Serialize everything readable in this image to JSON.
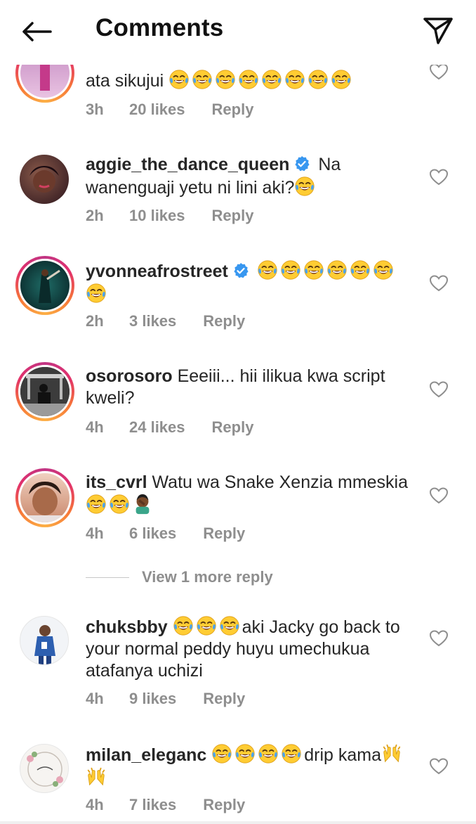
{
  "header": {
    "title": "Comments"
  },
  "comments": [
    {
      "username": "",
      "verified": false,
      "ring": true,
      "text_a": "ata sikujui ",
      "text_b": "",
      "time": "3h",
      "likes": "20 likes",
      "reply": "Reply",
      "avatar_color": "#d9a9d3"
    },
    {
      "username": "aggie_the_dance_queen",
      "verified": true,
      "ring": false,
      "text_a": "Na wanenguaji yetu ni lini aki?",
      "text_b": "",
      "time": "2h",
      "likes": "10 likes",
      "reply": "Reply",
      "avatar_color": "#3a1f2a"
    },
    {
      "username": "yvonneafrostreet",
      "verified": true,
      "ring": true,
      "text_a": "",
      "text_b": "",
      "time": "2h",
      "likes": "3 likes",
      "reply": "Reply",
      "avatar_color": "#0f3f3f"
    },
    {
      "username": "osorosoro",
      "verified": false,
      "ring": true,
      "text_a": "Eeeiii... hii ilikua kwa script kweli?",
      "text_b": "",
      "time": "4h",
      "likes": "24 likes",
      "reply": "Reply",
      "avatar_color": "#2a2a2a"
    },
    {
      "username": "its_cvrl",
      "verified": false,
      "ring": true,
      "text_a": "Watu wa Snake Xenzia mmeskia",
      "text_b": "",
      "time": "4h",
      "likes": "6 likes",
      "reply": "Reply",
      "avatar_color": "#d8a27a"
    },
    {
      "username": "chuksbby",
      "verified": false,
      "ring": false,
      "text_a": "aki Jacky go back to your normal peddy huyu umechukua atafanya uchizi",
      "text_b": "",
      "time": "4h",
      "likes": "9 likes",
      "reply": "Reply",
      "avatar_color": "#e8eef5"
    },
    {
      "username": "milan_eleganc",
      "verified": false,
      "ring": false,
      "text_a": "drip kama",
      "text_b": "",
      "time": "4h",
      "likes": "7 likes",
      "reply": "Reply",
      "avatar_color": "#f3f1ee"
    }
  ],
  "view_more": {
    "label": "View 1 more reply"
  },
  "icons": {
    "back": "arrow-left-icon",
    "send": "paper-plane-icon",
    "heart": "heart-outline-icon",
    "verified": "verified-badge-icon",
    "emoji_laugh": "face-with-tears-of-joy-emoji",
    "emoji_facepalm": "man-facepalming-emoji",
    "emoji_hands": "raising-hands-emoji"
  },
  "colors": {
    "text": "#262626",
    "meta": "#8e8e8e",
    "verified": "#3897f0",
    "emoji_face": "#ffcc33",
    "emoji_tear": "#4aa3f0"
  }
}
